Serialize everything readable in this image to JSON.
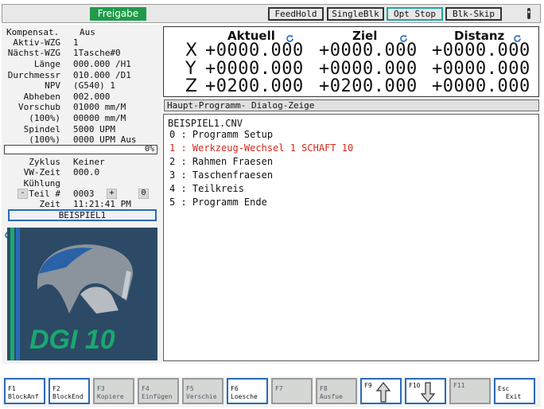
{
  "topbar": {
    "freigabe": "Freigabe",
    "buttons": [
      "FeedHold",
      "SingleBlk",
      "Opt Stop",
      "Blk-Skip"
    ]
  },
  "status": {
    "kompensat_label": "Kompensat.",
    "kompensat_value": "Aus",
    "aktiv_wzg_label": "Aktiv-WZG",
    "aktiv_wzg_value": "1",
    "naechst_wzg_label": "Nächst-WZG",
    "naechst_wzg_value": "1Tasche#0",
    "laenge_label": "Länge",
    "laenge_value": "000.000 /H1",
    "durchmessr_label": "Durchmessr",
    "durchmessr_value": "010.000 /D1",
    "npv_label": "NPV",
    "npv_value": "(G540) 1",
    "abheben_label": "Abheben",
    "abheben_value": "002.000",
    "vorschub_label": "Vorschub",
    "vorschub_value": "01000 mm/M",
    "vorschub_pct_label": "(100%)",
    "vorschub_pct_value": "00000 mm/M",
    "spindel_label": "Spindel",
    "spindel_value": "5000 UPM",
    "spindel_pct_label": "(100%)",
    "spindel_pct_value": "0000 UPM Aus",
    "progress_text": "0%",
    "progress": 0,
    "zyklus_label": "Zyklus",
    "zyklus_value": "Keiner",
    "vwzeit_label": "VW-Zeit",
    "vwzeit_value": "000.0",
    "kuehlung_label": "Kühlung",
    "kuehlung_value": "",
    "teil_minus": "-",
    "teil_label": "Teil #",
    "teil_value": "0003",
    "teil_plus": "+",
    "teil_zero": "0",
    "zeit_label": "Zeit",
    "zeit_value": "11:21:41 PM",
    "program_name": "BEISPIEL1"
  },
  "logo": {
    "text": "DGI 10"
  },
  "coords": {
    "headers": [
      "Aktuell",
      "Ziel",
      "Distanz"
    ],
    "rows": [
      {
        "axis": "X",
        "aktuell": "+0000.000",
        "ziel": "+0000.000",
        "distanz": "+0000.000"
      },
      {
        "axis": "Y",
        "aktuell": "+0000.000",
        "ziel": "+0000.000",
        "distanz": "+0000.000"
      },
      {
        "axis": "Z",
        "aktuell": "+0200.000",
        "ziel": "+0200.000",
        "distanz": "+0000.000"
      }
    ]
  },
  "program": {
    "title": "Haupt-Programm-  Dialog-Zeige",
    "filename": "BEISPIEL1.CNV",
    "lines": [
      "0 : Programm Setup",
      "1 : Werkzeug-Wechsel 1 SCHAFT 10",
      "2 : Rahmen Fraesen",
      "3 : Taschenfraesen",
      "4 : Teilkreis",
      "5 : Programm Ende"
    ],
    "active_color": "#d42a1a"
  },
  "fkeys": [
    {
      "key": "F1",
      "label": "BlockAnf"
    },
    {
      "key": "F2",
      "label": "BlockEnd"
    },
    {
      "key": "F3",
      "label": "Kopiere"
    },
    {
      "key": "F4",
      "label": "Einfügen"
    },
    {
      "key": "F5",
      "label": "Verschie"
    },
    {
      "key": "F6",
      "label": "Loesche"
    },
    {
      "key": "F7",
      "label": ""
    },
    {
      "key": "F8",
      "label": "Ausfue"
    },
    {
      "key": "F9",
      "label": ""
    },
    {
      "key": "F10",
      "label": ""
    },
    {
      "key": "F11",
      "label": ""
    },
    {
      "key": "Esc",
      "label": "Exit"
    }
  ],
  "colors": {
    "accent_blue": "#2a6ab7",
    "freigabe_green": "#1f9b4a",
    "opt_stop_teal": "#1aa89e"
  }
}
